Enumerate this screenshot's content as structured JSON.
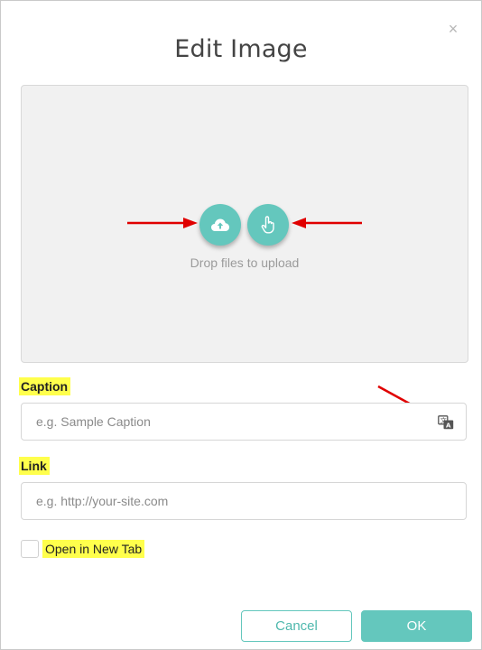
{
  "dialog": {
    "title": "Edit Image",
    "close_symbol": "×"
  },
  "dropzone": {
    "text": "Drop files to upload",
    "upload_icon": "cloud-upload-icon",
    "select_icon": "hand-pointer-icon"
  },
  "caption": {
    "label": "Caption",
    "placeholder": "e.g. Sample Caption",
    "value": "",
    "icon": "translate-icon"
  },
  "link": {
    "label": "Link",
    "placeholder": "e.g. http://your-site.com",
    "value": ""
  },
  "new_tab": {
    "label": "Open in New Tab",
    "checked": false
  },
  "actions": {
    "cancel_label": "Cancel",
    "ok_label": "OK"
  },
  "colors": {
    "accent": "#64c7bd",
    "highlight": "#ffff4c",
    "annotation_arrow": "#e00000"
  }
}
